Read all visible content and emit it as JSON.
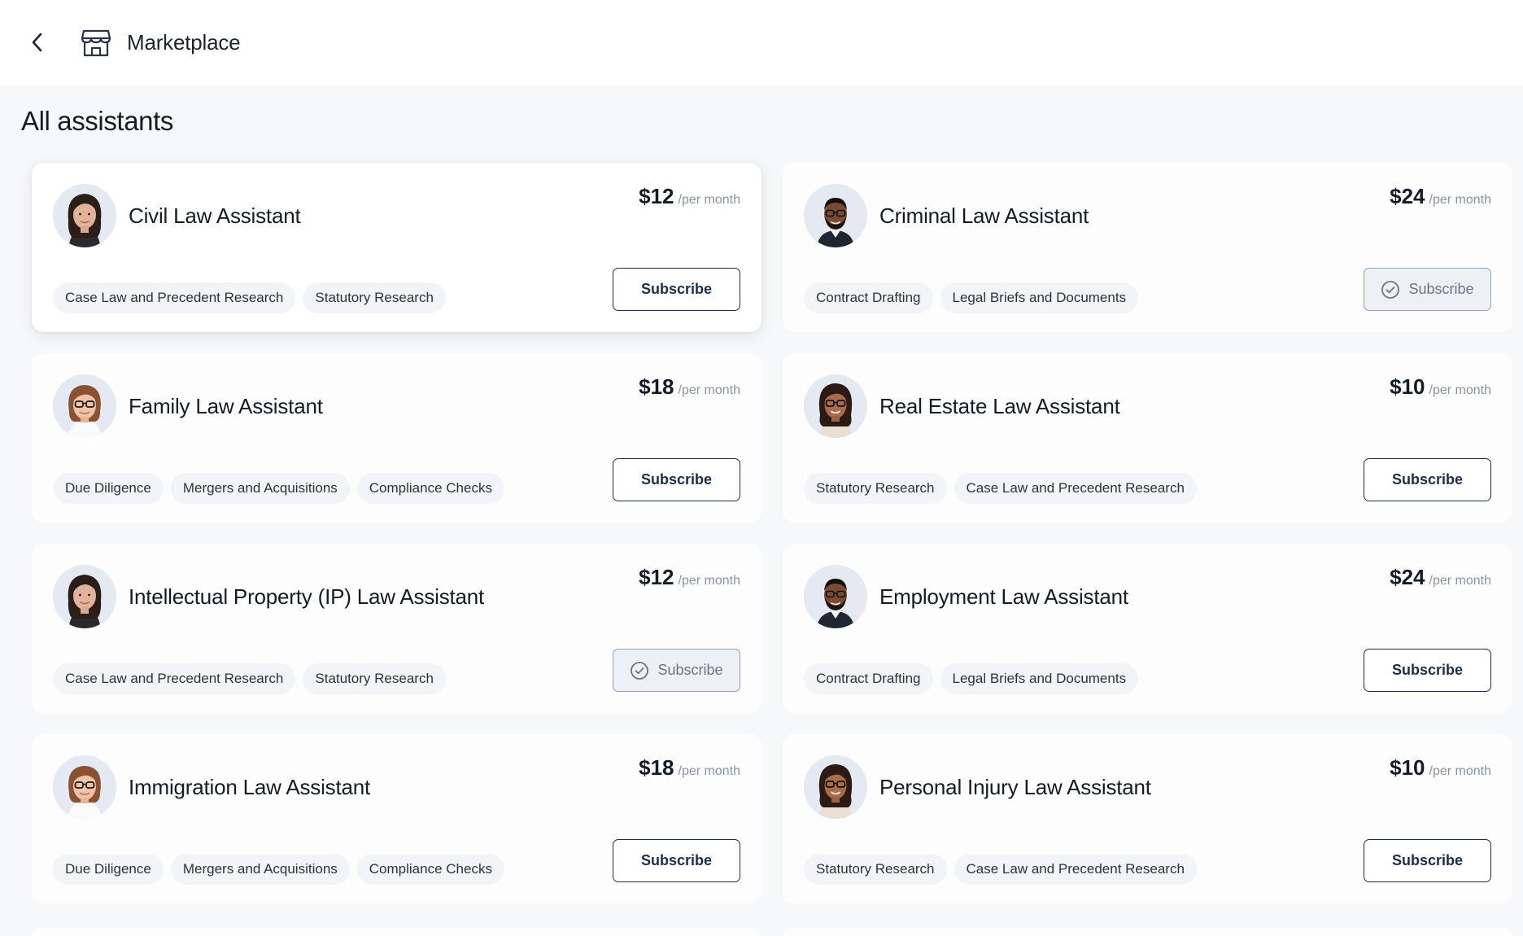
{
  "header": {
    "title": "Marketplace"
  },
  "section": {
    "title": "All assistants"
  },
  "cards": [
    {
      "name": "Civil Law Assistant",
      "price": "$12",
      "period": "/per month",
      "avatar": "woman-dark-hair",
      "tags": [
        "Case Law and Precedent Research",
        "Statutory Research"
      ],
      "button": "Subscribe",
      "subscribed": false,
      "raised": true
    },
    {
      "name": "Criminal Law Assistant",
      "price": "$24",
      "period": "/per month",
      "avatar": "man-glasses-beard",
      "tags": [
        "Contract Drafting",
        "Legal Briefs and Documents"
      ],
      "button": "Subscribe",
      "subscribed": true,
      "raised": false
    },
    {
      "name": "Family Law Assistant",
      "price": "$18",
      "period": "/per month",
      "avatar": "woman-glasses-auburn",
      "tags": [
        "Due Diligence",
        "Mergers and Acquisitions",
        "Compliance Checks"
      ],
      "button": "Subscribe",
      "subscribed": false,
      "raised": false
    },
    {
      "name": "Real Estate Law Assistant",
      "price": "$10",
      "period": "/per month",
      "avatar": "woman-glasses-curly",
      "tags": [
        "Statutory Research",
        "Case Law and Precedent Research"
      ],
      "button": "Subscribe",
      "subscribed": false,
      "raised": false
    },
    {
      "name": "Intellectual Property (IP) Law Assistant",
      "price": "$12",
      "period": "/per month",
      "avatar": "woman-dark-hair",
      "tags": [
        "Case Law and Precedent Research",
        "Statutory Research"
      ],
      "button": "Subscribe",
      "subscribed": true,
      "raised": false
    },
    {
      "name": "Employment Law Assistant",
      "price": "$24",
      "period": "/per month",
      "avatar": "man-glasses-beard",
      "tags": [
        "Contract Drafting",
        "Legal Briefs and Documents"
      ],
      "button": "Subscribe",
      "subscribed": false,
      "raised": false
    },
    {
      "name": "Immigration Law Assistant",
      "price": "$18",
      "period": "/per month",
      "avatar": "woman-glasses-auburn",
      "tags": [
        "Due Diligence",
        "Mergers and Acquisitions",
        "Compliance Checks"
      ],
      "button": "Subscribe",
      "subscribed": false,
      "raised": false
    },
    {
      "name": "Personal Injury Law Assistant",
      "price": "$10",
      "period": "/per month",
      "avatar": "woman-glasses-curly",
      "tags": [
        "Statutory Research",
        "Case Law and Precedent Research"
      ],
      "button": "Subscribe",
      "subscribed": false,
      "raised": false
    }
  ],
  "icons": {
    "back": "chevron-left-icon",
    "store": "storefront-icon",
    "check": "check-circle-icon"
  },
  "colors": {
    "background": "#f7f8fa",
    "button_border": "#1b2f48",
    "tag_bg": "#f2f4f7",
    "subscribed_bg": "#edf0f4"
  }
}
